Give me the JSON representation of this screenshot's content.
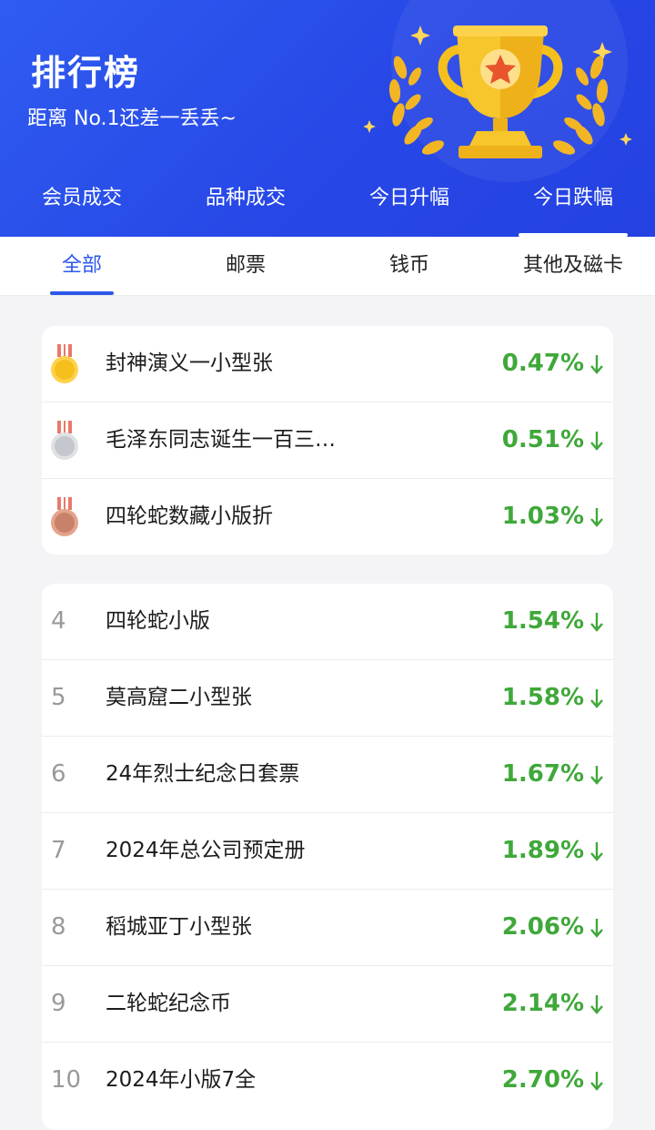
{
  "header": {
    "title": "排行榜",
    "subtitle": "距离 No.1还差一丢丢~"
  },
  "main_tabs": [
    {
      "label": "会员成交",
      "active": false
    },
    {
      "label": "品种成交",
      "active": false
    },
    {
      "label": "今日升幅",
      "active": false
    },
    {
      "label": "今日跌幅",
      "active": true
    }
  ],
  "sub_tabs": [
    {
      "label": "全部",
      "active": true
    },
    {
      "label": "邮票",
      "active": false
    },
    {
      "label": "钱币",
      "active": false
    },
    {
      "label": "其他及磁卡",
      "active": false
    }
  ],
  "top3": [
    {
      "medal": "gold-medal-icon",
      "name": "封神演义一小型张",
      "pct": "0.47%"
    },
    {
      "medal": "silver-medal-icon",
      "name": "毛泽东同志诞生一百三…",
      "pct": "0.51%"
    },
    {
      "medal": "bronze-medal-icon",
      "name": "四轮蛇数藏小版折",
      "pct": "1.03%"
    }
  ],
  "rest": [
    {
      "rank": "4",
      "name": "四轮蛇小版",
      "pct": "1.54%"
    },
    {
      "rank": "5",
      "name": "莫高窟二小型张",
      "pct": "1.58%"
    },
    {
      "rank": "6",
      "name": "24年烈士纪念日套票",
      "pct": "1.67%"
    },
    {
      "rank": "7",
      "name": "2024年总公司预定册",
      "pct": "1.89%"
    },
    {
      "rank": "8",
      "name": "稻城亚丁小型张",
      "pct": "2.06%"
    },
    {
      "rank": "9",
      "name": "二轮蛇纪念币",
      "pct": "2.14%"
    },
    {
      "rank": "10",
      "name": "2024年小版7全",
      "pct": "2.70%"
    }
  ],
  "colors": {
    "header_blue": "#2747e6",
    "active_tab": "#2d57ea",
    "down_green": "#3fa83a",
    "gold": "#f5c01e",
    "silver": "#c4c7cc",
    "bronze": "#c9826a"
  }
}
